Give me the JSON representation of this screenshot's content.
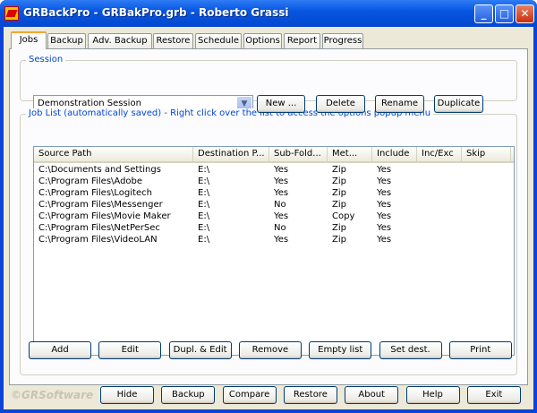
{
  "window": {
    "title": "GRBackPro - GRBakPro.grb - Roberto Grassi",
    "controls": [
      "minimize",
      "maximize",
      "close"
    ]
  },
  "tabs": [
    {
      "label": "Jobs",
      "active": true
    },
    {
      "label": "Backup"
    },
    {
      "label": "Adv. Backup"
    },
    {
      "label": "Restore"
    },
    {
      "label": "Schedule"
    },
    {
      "label": "Options"
    },
    {
      "label": "Report"
    },
    {
      "label": "Progress"
    }
  ],
  "session": {
    "label": "Session",
    "selected": "Demonstration Session",
    "buttons": [
      "New ...",
      "Delete",
      "Rename",
      "Duplicate"
    ]
  },
  "joblist": {
    "label": "Job List (automatically saved) - Right click over the list to access the options popup menu",
    "columns": [
      "Source Path",
      "Destination P...",
      "Sub-Fold...",
      "Met...",
      "Include",
      "Inc/Exc",
      "Skip"
    ],
    "rows": [
      [
        "C:\\Documents and Settings",
        "E:\\",
        "Yes",
        "Zip",
        "Yes",
        "",
        ""
      ],
      [
        "C:\\Program Files\\Adobe",
        "E:\\",
        "Yes",
        "Zip",
        "Yes",
        "",
        ""
      ],
      [
        "C:\\Program Files\\Logitech",
        "E:\\",
        "Yes",
        "Zip",
        "Yes",
        "",
        ""
      ],
      [
        "C:\\Program Files\\Messenger",
        "E:\\",
        "No",
        "Zip",
        "Yes",
        "",
        ""
      ],
      [
        "C:\\Program Files\\Movie Maker",
        "E:\\",
        "Yes",
        "Copy",
        "Yes",
        "",
        ""
      ],
      [
        "C:\\Program Files\\NetPerSec",
        "E:\\",
        "No",
        "Zip",
        "Yes",
        "",
        ""
      ],
      [
        "C:\\Program Files\\VideoLAN",
        "E:\\",
        "Yes",
        "Zip",
        "Yes",
        "",
        ""
      ]
    ],
    "buttons": [
      "Add",
      "Edit",
      "Dupl. & Edit",
      "Remove",
      "Empty list",
      "Set dest.",
      "Print"
    ]
  },
  "footer": {
    "brand": "©GRSoftware",
    "buttons": [
      "Hide",
      "Backup",
      "Compare",
      "Restore",
      "About",
      "Help",
      "Exit"
    ]
  }
}
